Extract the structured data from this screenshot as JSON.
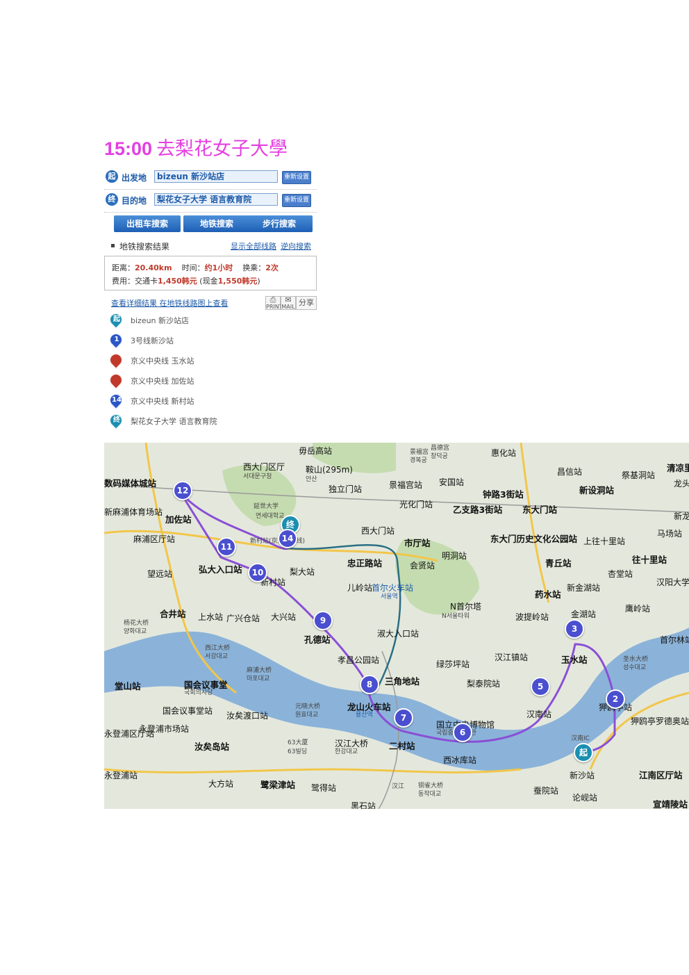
{
  "title": {
    "time": "15:00",
    "text": "去梨花女子大學"
  },
  "panel": {
    "start_badge": "起",
    "end_badge": "终",
    "origin_label": "出发地",
    "origin_value": "bizeun 新沙站店",
    "dest_label": "目的地",
    "dest_value": "梨花女子大学 语言教育院",
    "reset_label": "重新设置",
    "buttons": [
      "出租车搜索",
      "地铁搜索",
      "步行搜索"
    ],
    "results_title": "地铁搜索结果",
    "show_all_link": "显示全部线路",
    "reverse_link": "逆向搜索",
    "summary": {
      "distance_label": "距离：",
      "distance": "20.40km",
      "time_label": "时间：",
      "time": "约1小时",
      "transfer_label": "换乘：",
      "transfer": "2次",
      "fee_label": "费用：交通卡",
      "fee_card": "1,450韩元",
      "fee_cash_pre": "(现金",
      "fee_cash": "1,550韩元",
      "fee_cash_post": ")"
    },
    "detail_link": "查看详细结果",
    "subway_map_link": "在地铁线路图上查看",
    "print_label": "PRINT",
    "mail_label": "MAIL",
    "share_label": "分享"
  },
  "steps": [
    {
      "badge": "起",
      "text": "bizeun 新沙站店",
      "color": "#1b8fb0"
    },
    {
      "badge": "1",
      "text": "3号线新沙站",
      "color": "#2a56c6"
    },
    {
      "badge": "",
      "text": "京义中央线 玉水站",
      "color": "#c0392b"
    },
    {
      "badge": "",
      "text": "京义中央线 加佐站",
      "color": "#c0392b"
    },
    {
      "badge": "14",
      "text": "京义中央线 新村站",
      "color": "#2a56c6"
    },
    {
      "badge": "终",
      "text": "梨花女子大学 语言教育院",
      "color": "#1b8fb0"
    }
  ],
  "map": {
    "colors": {
      "river": "#8bb3d9",
      "route": "#8a4fd6",
      "green": "#bcd6a6",
      "road": "#f2c64a"
    },
    "markers": [
      "12",
      "11",
      "10",
      "9",
      "8",
      "7",
      "6",
      "5",
      "3",
      "2",
      "终",
      "14",
      "起"
    ],
    "labels": [
      "西大门区厅",
      "서대문구청",
      "毋岳高站",
      "鞍山(295m)",
      "안산",
      "独立门站",
      "景福宫站",
      "安国站",
      "钟路3街站",
      "东大门站",
      "乙支路3街站",
      "光化门站",
      "新设洞站",
      "祭基洞站",
      "清凉里",
      "数码媒体城站",
      "加佐站",
      "延世大学",
      "연세대학교",
      "新村站(京义中央线)",
      "西大门站",
      "市厅站",
      "东大门历史文化公园站",
      "上往十里站",
      "往十里站",
      "马场站",
      "新村站",
      "梨大站",
      "忠正路站",
      "首尔火车站",
      "서울역",
      "弘大入口站",
      "会贤站",
      "明洞站",
      "青丘站",
      "杏堂站",
      "汉阳大学",
      "望远站",
      "儿岭站",
      "药水站",
      "新金湖站",
      "麻浦区厅站",
      "合井站",
      "上水站",
      "广兴仓站",
      "大兴站",
      "孔德站",
      "淑大入口站",
      "N首尔塔",
      "N서울타워",
      "波提岭站",
      "金湖站",
      "鹰岭站",
      "杨花大桥",
      "양화대교",
      "西江大桥",
      "서강대교",
      "麻浦大桥",
      "마포대교",
      "孝昌公园站",
      "三角地站",
      "绿莎坪站",
      "梨泰院站",
      "汉江镇站",
      "玉水站",
      "圣水大桥",
      "성수대교",
      "首尔林站",
      "堂山站",
      "国会议事堂",
      "국회의사당",
      "国会议事堂站",
      "汝矣渡口站",
      "元晓大桥",
      "원효대교",
      "龙山火车站",
      "용산역",
      "国立中央博物馆",
      "국립중앙박물관",
      "汉南站",
      "狎鸥亭站",
      "狎鸥亭罗德奥站",
      "汉南IC",
      "永登浦市场站",
      "汝矣岛站",
      "63大厦",
      "63빌딩",
      "汉江大桥",
      "한강대교",
      "二村站",
      "西冰库站",
      "新沙站",
      "江南区厅站",
      "永登浦区厅站",
      "永登浦站",
      "大方站",
      "鹭梁津站",
      "鹭得站",
      "汉江",
      "铜雀大桥",
      "동작대교",
      "蚕院站",
      "论岘站",
      "宣靖陵站",
      "黑石站",
      "惠化站",
      "昌信站",
      "龙头站",
      "新麻浦体育场站",
      "昌德宫",
      "창덕궁",
      "景福宫",
      "경복궁",
      "新龙"
    ]
  }
}
